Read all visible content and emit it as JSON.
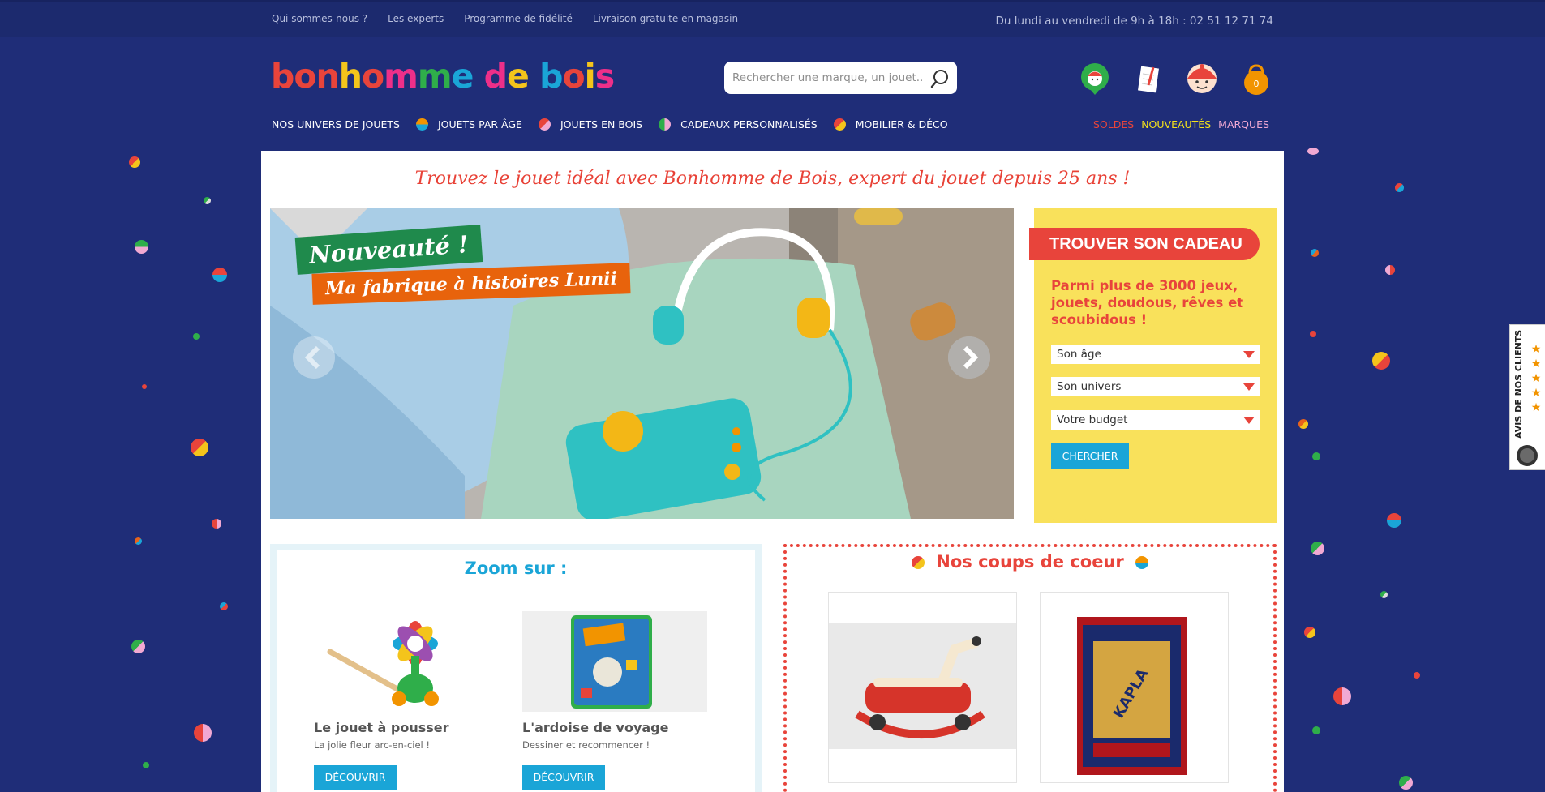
{
  "topbar": {
    "links": [
      "Qui sommes-nous ?",
      "Les experts",
      "Programme de fidélité",
      "Livraison gratuite en magasin"
    ],
    "hours": "Du lundi au vendredi de 9h à 18h : 02 51 12 71 74"
  },
  "header": {
    "logo_letters": [
      {
        "ch": "b",
        "color": "#e8443b"
      },
      {
        "ch": "o",
        "color": "#e8443b"
      },
      {
        "ch": "n",
        "color": "#e8443b"
      },
      {
        "ch": "h",
        "color": "#f4c41b"
      },
      {
        "ch": "o",
        "color": "#e8443b"
      },
      {
        "ch": "m",
        "color": "#ed2f89"
      },
      {
        "ch": "m",
        "color": "#2fae4a"
      },
      {
        "ch": "e",
        "color": "#1aa5d7"
      },
      {
        "ch": " ",
        "color": "#fff"
      },
      {
        "ch": "d",
        "color": "#ed2f89"
      },
      {
        "ch": "e",
        "color": "#f4c41b"
      },
      {
        "ch": " ",
        "color": "#fff"
      },
      {
        "ch": "b",
        "color": "#1aa5d7"
      },
      {
        "ch": "o",
        "color": "#e8443b"
      },
      {
        "ch": "i",
        "color": "#f4c41b"
      },
      {
        "ch": "s",
        "color": "#ed2f89"
      }
    ],
    "search_placeholder": "Rechercher une marque, un jouet...",
    "cart_count": "0"
  },
  "nav": {
    "items": [
      "Nos univers de jouets",
      "Jouets par âge",
      "Jouets en bois",
      "Cadeaux personnalisés",
      "Mobilier & Déco"
    ],
    "right": [
      {
        "label": "SOLDES",
        "color": "#e8443b"
      },
      {
        "label": "NOUVEAUTÉS",
        "color": "#f4e11b"
      },
      {
        "label": "MARQUES",
        "color": "#f1a9d3"
      }
    ]
  },
  "main": {
    "tagline": "Trouvez le jouet idéal avec Bonhomme de Bois, expert du jouet depuis 25 ans !",
    "hero": {
      "badge1": "Nouveauté !",
      "badge2": "Ma fabrique à histoires Lunii"
    },
    "gift": {
      "title": "TROUVER SON CADEAU",
      "desc": "Parmi plus de 3000 jeux, jouets, doudous, rêves et scoubidous !",
      "selects": [
        "Son âge",
        "Son univers",
        "Votre budget"
      ],
      "button": "CHERCHER"
    },
    "zoom": {
      "title": "Zoom sur :",
      "cards": [
        {
          "title": "Le jouet à pousser",
          "subtitle": "La jolie fleur arc-en-ciel !",
          "button": "DÉCOUVRIR"
        },
        {
          "title": "L'ardoise de voyage",
          "subtitle": "Dessiner et recommencer !",
          "button": "DÉCOUVRIR"
        }
      ]
    },
    "coeur": {
      "title": "Nos coups de coeur"
    }
  },
  "reviews_tab": {
    "label": "AVIS DE NOS CLIENTS"
  }
}
